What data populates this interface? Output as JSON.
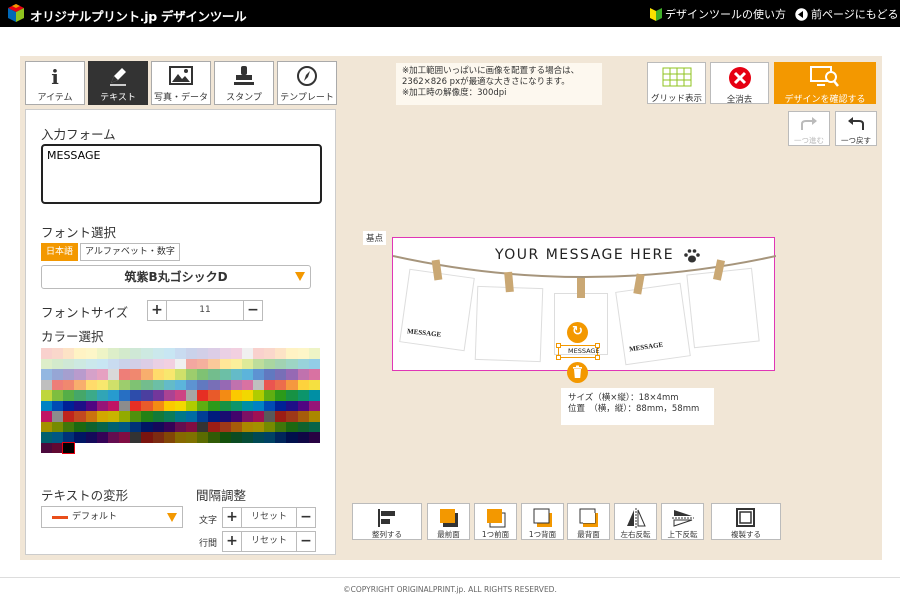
{
  "header": {
    "brand": "オリジナルプリント.jp デザインツール",
    "guide_label": "デザインツールの使い方",
    "back_label": "前ページにもどる"
  },
  "tabs": [
    {
      "label": "アイテム",
      "icon": "info-icon"
    },
    {
      "label": "テキスト",
      "icon": "pen-icon"
    },
    {
      "label": "写真・データ",
      "icon": "image-icon"
    },
    {
      "label": "スタンプ",
      "icon": "stamp-icon"
    },
    {
      "label": "テンプレート",
      "icon": "compass-icon"
    }
  ],
  "form": {
    "input_label": "入力フォーム",
    "input_value": "MESSAGE",
    "font_label": "フォント選択",
    "font_tab_ja": "日本語",
    "font_tab_en": "アルファベット・数字",
    "font_selected": "筑紫B丸ゴシックD",
    "size_label": "フォントサイズ",
    "size_value": "11",
    "color_label": "カラー選択",
    "deform_label": "テキストの変形",
    "deform_value": "デフォルト",
    "spacing_label": "間隔調整",
    "char_label": "文字",
    "line_label": "行間",
    "reset_label": "リセット",
    "plus": "+",
    "minus": "−"
  },
  "palette_columns": [
    [
      "#f9d1cd",
      "#f3a7a0",
      "#ee7e78",
      "#ea5550",
      "#e62f24",
      "#c0251c",
      "#9c1d15",
      "#7a140e"
    ],
    [
      "#fad7cb",
      "#f5b09d",
      "#f0886f",
      "#ec6d4c",
      "#e85a2a",
      "#c24820",
      "#9e3818",
      "#7c2a11"
    ],
    [
      "#fde3c6",
      "#fac99a",
      "#f8ae6d",
      "#f5983f",
      "#f38b14",
      "#cb720e",
      "#a65c0a",
      "#824606"
    ],
    [
      "#fff3c4",
      "#ffe798",
      "#ffdb6b",
      "#fdd23d",
      "#fbc900",
      "#d2a700",
      "#ab8700",
      "#866900"
    ],
    [
      "#fdf6c8",
      "#fbef9b",
      "#f8e76e",
      "#f5e040",
      "#f2d800",
      "#c9b400",
      "#a39100",
      "#7f7100"
    ],
    [
      "#eef4c6",
      "#deea98",
      "#cfe06a",
      "#bfd63c",
      "#b0cc00",
      "#92aa00",
      "#768a00",
      "#5b6b00"
    ],
    [
      "#ddeec9",
      "#bddd9b",
      "#9dcd6d",
      "#7ebe3f",
      "#5fae11",
      "#4f910d",
      "#40760a",
      "#315b06"
    ],
    [
      "#d3eacc",
      "#a9d6a0",
      "#7fc273",
      "#55ae47",
      "#2b9a1a",
      "#238115",
      "#1c6811",
      "#14500c"
    ],
    [
      "#cfe8d6",
      "#a1d2b2",
      "#73bd8d",
      "#45a769",
      "#179244",
      "#137a38",
      "#0f622d",
      "#0b4b22"
    ],
    [
      "#cde9e1",
      "#9dd4c4",
      "#6cbfa6",
      "#3caa89",
      "#0c956b",
      "#0a7c59",
      "#086448",
      "#064c37"
    ],
    [
      "#cbe8ec",
      "#98d2da",
      "#64bbc8",
      "#31a5b6",
      "#008fa4",
      "#007789",
      "#00606e",
      "#004954"
    ],
    [
      "#c8e6f3",
      "#92cde7",
      "#5cb4db",
      "#279bcf",
      "#0082c3",
      "#006ca3",
      "#005783",
      "#004264"
    ],
    [
      "#c9dbf0",
      "#93b7e1",
      "#5d93d2",
      "#276fc3",
      "#004bb4",
      "#003e96",
      "#003278",
      "#00265b"
    ],
    [
      "#cad2ea",
      "#96a6d5",
      "#6179c0",
      "#2d4dab",
      "#002196",
      "#001b7d",
      "#001664",
      "#00104c"
    ],
    [
      "#d2cfe7",
      "#a59fcf",
      "#786fb7",
      "#4b3f9f",
      "#1e0f87",
      "#190c71",
      "#140a5a",
      "#0f0745"
    ],
    [
      "#dccde6",
      "#b99bcd",
      "#9669b4",
      "#73379b",
      "#500582",
      "#42046c",
      "#350357",
      "#280242"
    ],
    [
      "#ead0e4",
      "#d5a1c9",
      "#c072ae",
      "#ab4393",
      "#961478",
      "#7d1064",
      "#640d50",
      "#4c093d"
    ],
    [
      "#f2d0e0",
      "#e6a1c1",
      "#d972a2",
      "#cd4383",
      "#c01464",
      "#a01053",
      "#800d42",
      "#610932"
    ],
    [
      "#f0f0f0",
      "#d9d9d9",
      "#bfbfbf",
      "#a6a6a6",
      "#8c8c8c",
      "#595959",
      "#333333",
      "#000000"
    ]
  ],
  "notice": {
    "line1": "※加工範囲いっぱいに画像を配置する場合は、",
    "line2": "2362×826 pxが最適な大きさになります。",
    "line3": "※加工時の解像度：300dpi"
  },
  "toolbar": {
    "grid": "グリッド表示",
    "clear": "全消去",
    "confirm": "デザインを確認する",
    "redo": "一つ進む",
    "undo": "一つ戻す"
  },
  "canvas": {
    "ref_point": "基点",
    "title": "YOUR MESSAGE HERE",
    "tag1": "MESSAGE",
    "tag2": "MESSAGE",
    "tag3": "MESSAGE",
    "selected_text": "MESSAGE",
    "info_size": "サイズ（横×縦）：18×4mm",
    "info_pos": "位置　（横，縦）：88mm，58mm"
  },
  "bottom_toolbar": [
    {
      "label": "整列する",
      "icon": "align-icon"
    },
    {
      "label": "最前面",
      "icon": "bring-front-icon"
    },
    {
      "label": "1つ前面",
      "icon": "bring-forward-icon"
    },
    {
      "label": "1つ背面",
      "icon": "send-backward-icon"
    },
    {
      "label": "最背面",
      "icon": "send-back-icon"
    },
    {
      "label": "左右反転",
      "icon": "flip-horizontal-icon"
    },
    {
      "label": "上下反転",
      "icon": "flip-vertical-icon"
    },
    {
      "label": "複製する",
      "icon": "duplicate-icon"
    }
  ],
  "colors": {
    "accent": "#f39800",
    "selection": "#e036b6",
    "workspace": "#f1e6d6"
  },
  "footer": "©COPYRIGHT ORIGINALPRINT.jp. ALL RIGHTS RESERVED."
}
